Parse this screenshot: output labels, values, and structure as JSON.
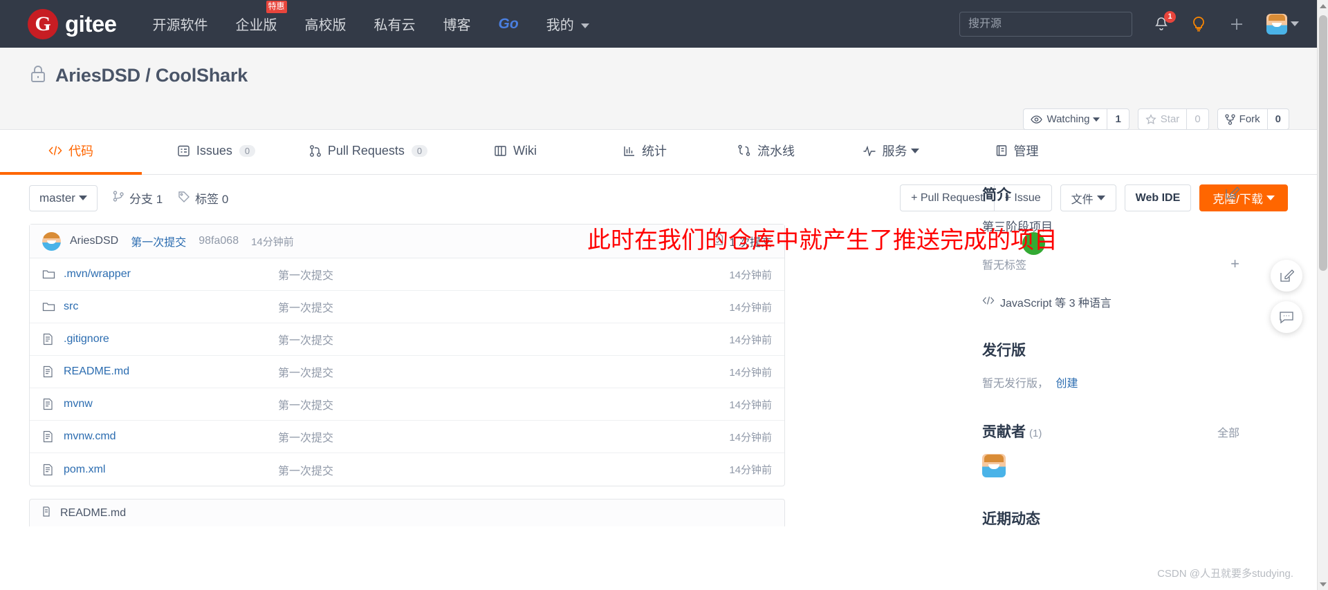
{
  "topnav": {
    "brand_mark": "G",
    "brand_name": "gitee",
    "links": [
      {
        "label": "开源软件",
        "badge": null,
        "style": "normal"
      },
      {
        "label": "企业版",
        "badge": "特惠",
        "style": "normal"
      },
      {
        "label": "高校版",
        "badge": null,
        "style": "normal"
      },
      {
        "label": "私有云",
        "badge": null,
        "style": "normal"
      },
      {
        "label": "博客",
        "badge": null,
        "style": "normal"
      },
      {
        "label": "Go",
        "badge": null,
        "style": "go"
      },
      {
        "label": "我的",
        "badge": null,
        "style": "dropdown"
      }
    ],
    "search_placeholder": "搜开源",
    "search_value": "",
    "notification_icon": "bell-icon",
    "notification_count": "1",
    "idea_icon": "lightbulb-icon",
    "add_icon": "plus-icon",
    "avatar_icon": "user-avatar",
    "background": "#333a47"
  },
  "repo": {
    "visibility_icon": "lock-icon",
    "owner": "AriesDSD",
    "separator": "/",
    "name": "CoolShark",
    "full_title": "AriesDSD / CoolShark",
    "watch": {
      "icon": "eye-icon",
      "label": "Watching",
      "count": "1"
    },
    "star": {
      "icon": "star-icon",
      "label": "Star",
      "count": "0"
    },
    "fork": {
      "icon": "fork-icon",
      "label": "Fork",
      "count": "0"
    }
  },
  "tabs": [
    {
      "label": "代码",
      "icon": "code-icon",
      "count": null,
      "active": true
    },
    {
      "label": "Issues",
      "icon": "issue-icon",
      "count": "0",
      "active": false
    },
    {
      "label": "Pull Requests",
      "icon": "pull-request-icon",
      "count": "0",
      "active": false
    },
    {
      "label": "Wiki",
      "icon": "book-icon",
      "count": null,
      "active": false
    },
    {
      "label": "统计",
      "icon": "chart-icon",
      "count": null,
      "active": false
    },
    {
      "label": "流水线",
      "icon": "pipeline-icon",
      "count": null,
      "active": false
    },
    {
      "label": "服务",
      "icon": "service-icon",
      "count": null,
      "active": false,
      "dropdown": true
    },
    {
      "label": "管理",
      "icon": "manage-icon",
      "count": null,
      "active": false
    }
  ],
  "toolbar": {
    "branch": "master",
    "branches_icon": "branch-icon",
    "branches_label": "分支 1",
    "tags_icon": "tag-icon",
    "tags_label": "标签 0",
    "pull_request_btn": "+ Pull Request",
    "issue_btn": "+ Issue",
    "files_btn": "文件",
    "web_ide_btn": "Web IDE",
    "clone_btn": "克隆/下载",
    "clone_color": "#ff6600"
  },
  "commit_bar": {
    "avatar": "user-avatar",
    "author": "AriesDSD",
    "message": "第一次提交",
    "sha": "98fa068",
    "time": "14分钟前",
    "count_icon": "commit-icon",
    "count_label": "1 次提交"
  },
  "files": [
    {
      "type": "folder",
      "name": ".mvn/wrapper",
      "message": "第一次提交",
      "time": "14分钟前"
    },
    {
      "type": "folder",
      "name": "src",
      "message": "第一次提交",
      "time": "14分钟前"
    },
    {
      "type": "file",
      "name": ".gitignore",
      "message": "第一次提交",
      "time": "14分钟前"
    },
    {
      "type": "file",
      "name": "README.md",
      "message": "第一次提交",
      "time": "14分钟前"
    },
    {
      "type": "file",
      "name": "mvnw",
      "message": "第一次提交",
      "time": "14分钟前"
    },
    {
      "type": "file",
      "name": "mvnw.cmd",
      "message": "第一次提交",
      "time": "14分钟前"
    },
    {
      "type": "file",
      "name": "pom.xml",
      "message": "第一次提交",
      "time": "14分钟前"
    }
  ],
  "readme_stub": {
    "icon": "book-icon",
    "label": "README.md"
  },
  "sidebar": {
    "intro_title": "简介",
    "intro_edit_icon": "edit-icon",
    "intro_text": "第三阶段项目",
    "tags_empty": "暂无标签",
    "tags_add_icon": "plus-icon",
    "language_icon": "code-icon",
    "language_text": "JavaScript 等 3 种语言",
    "release_title": "发行版",
    "release_empty": "暂无发行版，",
    "release_create": "创建",
    "contributors_title": "贡献者",
    "contributors_count": "(1)",
    "contributors_all": "全部",
    "activity_title": "近期动态"
  },
  "fabs": [
    {
      "icon": "edit-square-icon"
    },
    {
      "icon": "comment-icon"
    }
  ],
  "annotation": {
    "text": "此时在我们的仓库中就产生了推送完成的项目",
    "color": "#ff0000",
    "marker_icon": "green-circle-highlight"
  },
  "watermark": "CSDN @人丑就要多studying."
}
